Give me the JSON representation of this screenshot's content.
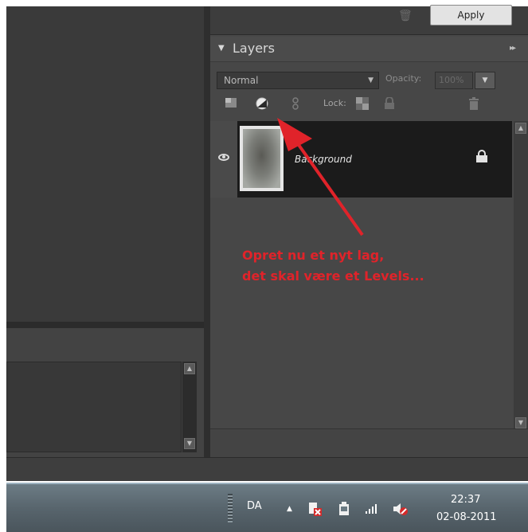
{
  "toolbar": {
    "apply_label": "Apply"
  },
  "layers_panel": {
    "title": "Layers",
    "blend_mode": "Normal",
    "opacity_label": "Opacity:",
    "opacity_value": "100%",
    "lock_label": "Lock:",
    "layers": [
      {
        "name": "Background",
        "visible": true,
        "locked": true
      }
    ]
  },
  "annotation": {
    "lines": [
      "Opret nu et nyt lag,",
      "det skal være et Levels..."
    ],
    "color": "#e0232a"
  },
  "taskbar": {
    "language": "DA",
    "time": "22:37",
    "date": "02-08-2011"
  },
  "icons": [
    "trash-icon",
    "layer-mask-icon",
    "adjustment-layer-icon",
    "link-icon",
    "lock-transparency-icon",
    "lock-all-icon",
    "eye-icon",
    "lock-icon",
    "red-arrow"
  ]
}
